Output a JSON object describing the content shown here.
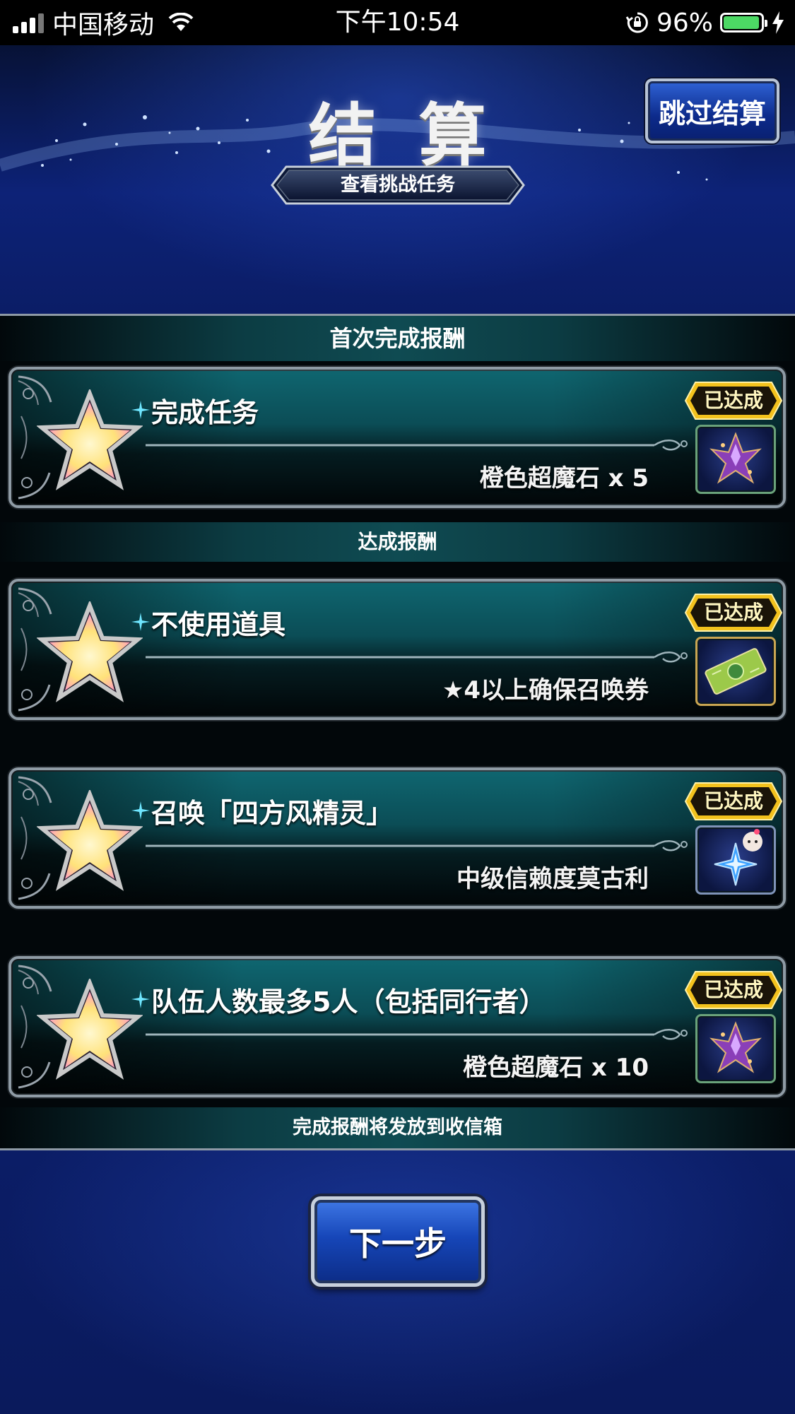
{
  "status_bar": {
    "carrier": "中国移动",
    "time": "下午10:54",
    "battery_percent": "96%",
    "battery_level": 0.96,
    "icons": [
      "signal-icon",
      "wifi-icon",
      "orientation-lock-icon",
      "battery-icon",
      "charging-icon"
    ]
  },
  "header": {
    "title": "结算",
    "skip_label": "跳过结算",
    "view_mission_label": "查看挑战任务"
  },
  "sections": {
    "first_clear": "首次完成报酬",
    "achievement": "达成报酬"
  },
  "missions": [
    {
      "name": "完成任务",
      "reward": "橙色超魔石 x 5",
      "status": "已达成",
      "item_icon": "crystal-icon"
    },
    {
      "name": "不使用道具",
      "reward": "★4以上确保召唤券",
      "status": "已达成",
      "item_icon": "ticket-icon"
    },
    {
      "name": "召唤「四方风精灵」",
      "reward": "中级信赖度莫古利",
      "status": "已达成",
      "item_icon": "moogle-icon"
    },
    {
      "name": "队伍人数最多5人（包括同行者）",
      "reward": "橙色超魔石 x 10",
      "status": "已达成",
      "item_icon": "crystal-icon"
    }
  ],
  "notice": "完成报酬将发放到收信箱",
  "next_label": "下一步",
  "colors": {
    "background_blue": "#0b1d66",
    "card_teal": "#0f6670",
    "badge_gold": "#e8b820",
    "button_blue": "#1646b8"
  }
}
